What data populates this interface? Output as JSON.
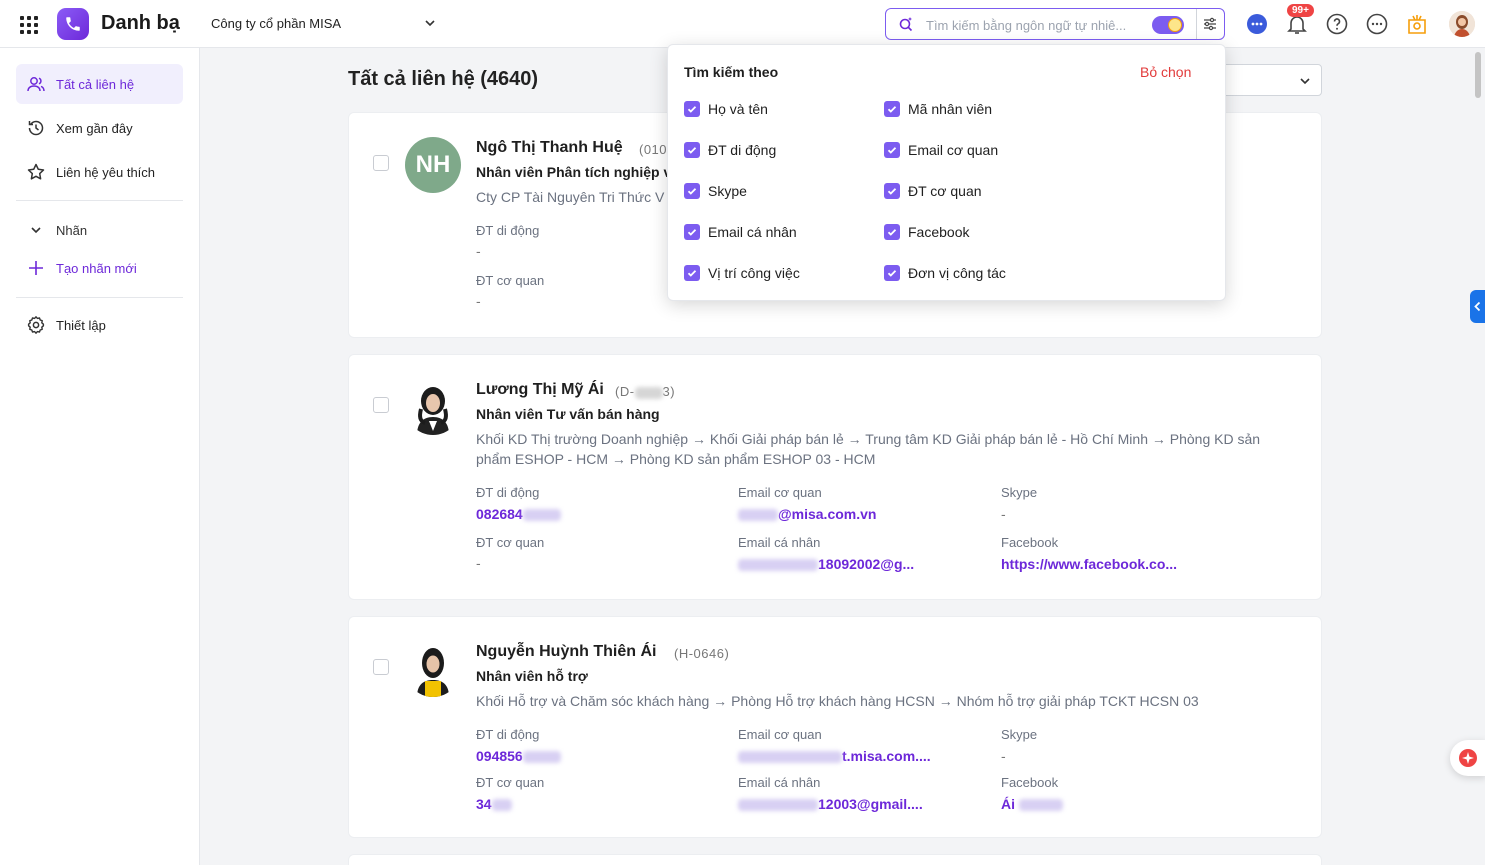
{
  "app": {
    "title": "Danh bạ",
    "company": "Công ty cổ phần MISA"
  },
  "search": {
    "placeholder": "Tìm kiếm bằng ngôn ngữ tự nhiê...",
    "value": ""
  },
  "notifications": {
    "badge": "99+"
  },
  "sidebar": {
    "items": [
      {
        "label": "Tất cả liên hệ",
        "icon": "contacts-icon",
        "active": true
      },
      {
        "label": "Xem gần đây",
        "icon": "history-icon"
      },
      {
        "label": "Liên hệ yêu thích",
        "icon": "star-icon"
      }
    ],
    "labels_header": "Nhãn",
    "create_label": "Tạo nhãn mới",
    "settings": "Thiết lập"
  },
  "main": {
    "title": "Tất cả liên hệ (4640)"
  },
  "search_filter": {
    "heading": "Tìm kiếm theo",
    "clear": "Bỏ chọn",
    "options": [
      {
        "label": "Họ và tên",
        "checked": true
      },
      {
        "label": "Mã nhân viên",
        "checked": true
      },
      {
        "label": "ĐT di động",
        "checked": true
      },
      {
        "label": "Email cơ quan",
        "checked": true
      },
      {
        "label": "Skype",
        "checked": true
      },
      {
        "label": "ĐT cơ quan",
        "checked": true
      },
      {
        "label": "Email cá nhân",
        "checked": true
      },
      {
        "label": "Facebook",
        "checked": true
      },
      {
        "label": "Vị trí công việc",
        "checked": true
      },
      {
        "label": "Đơn vị công tác",
        "checked": true
      }
    ]
  },
  "contacts": [
    {
      "initials": "NH",
      "name": "Ngô Thị Thanh Huệ",
      "code": "(010",
      "title": "Nhân viên Phân tích nghiệp v",
      "org": "Cty CP Tài Nguyên Tri Thức V",
      "mobile_label": "ĐT di động",
      "mobile": "-",
      "office_phone_label": "ĐT cơ quan",
      "office_phone": "-"
    },
    {
      "name": "Lương Thị Mỹ Ái",
      "code_prefix": "(D-",
      "code_suffix": "3)",
      "title": "Nhân viên Tư vấn bán hàng",
      "org": "Khối KD Thị trường Doanh nghiệp → Khối Giải pháp bán lẻ → Trung tâm KD Giải pháp bán lẻ - Hồ Chí Minh → Phòng KD sản phẩm ESHOP - HCM → Phòng KD sản phẩm ESHOP 03 - HCM",
      "mobile_label": "ĐT di động",
      "mobile": "082684",
      "work_email_label": "Email cơ quan",
      "work_email": "@misa.com.vn",
      "skype_label": "Skype",
      "skype": "-",
      "office_phone_label": "ĐT cơ quan",
      "office_phone": "-",
      "personal_email_label": "Email cá nhân",
      "personal_email": "18092002@g...",
      "facebook_label": "Facebook",
      "facebook": "https://www.facebook.co..."
    },
    {
      "name": "Nguyễn Huỳnh Thiên Ái",
      "code": "(H-0646)",
      "title": "Nhân viên hỗ trợ",
      "org": "Khối Hỗ trợ và Chăm sóc khách hàng → Phòng Hỗ trợ khách hàng HCSN → Nhóm hỗ trợ giải pháp TCKT HCSN 03",
      "mobile_label": "ĐT di động",
      "mobile": "094856",
      "work_email_label": "Email cơ quan",
      "work_email": "t.misa.com....",
      "skype_label": "Skype",
      "skype": "-",
      "office_phone_label": "ĐT cơ quan",
      "office_phone": "34",
      "personal_email_label": "Email cá nhân",
      "personal_email": "12003@gmail....",
      "facebook_label": "Facebook",
      "facebook": "Ái"
    }
  ],
  "colors": {
    "accent": "#7c5cf0",
    "danger": "#e23b3b",
    "avatar_green": "#7fa98a"
  }
}
